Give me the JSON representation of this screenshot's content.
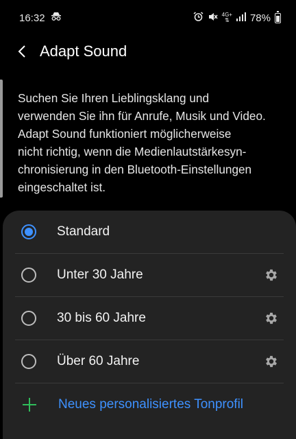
{
  "status_bar": {
    "time": "16:32",
    "network_label": "4G+",
    "battery": "78%"
  },
  "header": {
    "title": "Adapt Sound"
  },
  "description": "Suchen Sie Ihren Lieblingsklang und\nverwenden Sie ihn für Anrufe, Musik und Video.\nAdapt Sound funktioniert möglicherweise\nnicht richtig, wenn die Medienlautstärkesyn-\nchronisierung in den Bluetooth-Einstellungen\neingeschaltet ist.",
  "options": [
    {
      "label": "Standard",
      "selected": true
    },
    {
      "label": "Unter 30 Jahre",
      "selected": false
    },
    {
      "label": "30 bis 60 Jahre",
      "selected": false
    },
    {
      "label": "Über 60 Jahre",
      "selected": false
    }
  ],
  "add_profile": {
    "label": "Neues personalisiertes Tonprofil"
  },
  "colors": {
    "accent": "#3e91ff",
    "add_icon": "#2fbd5a",
    "card_bg": "#232323"
  }
}
